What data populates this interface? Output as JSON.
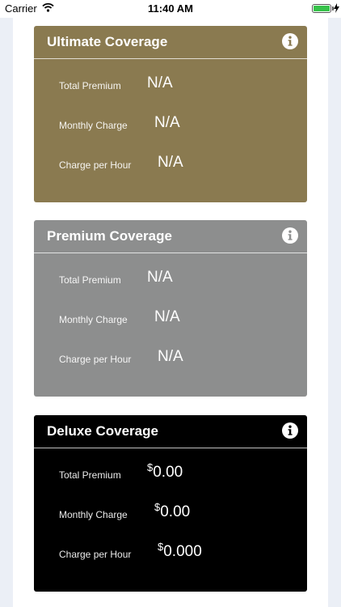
{
  "status_bar": {
    "carrier": "Carrier",
    "time": "11:40 AM"
  },
  "colors": {
    "ultimate": "#8a7a50",
    "premium": "#8d8e8e",
    "deluxe": "#000000",
    "battery": "#36c24a"
  },
  "cards": [
    {
      "title": "Ultimate Coverage",
      "rows": [
        {
          "label": "Total Premium",
          "currency": "",
          "value": "N/A"
        },
        {
          "label": "Monthly Charge",
          "currency": "",
          "value": "N/A"
        },
        {
          "label": "Charge per Hour",
          "currency": "",
          "value": "N/A"
        }
      ]
    },
    {
      "title": "Premium Coverage",
      "rows": [
        {
          "label": "Total Premium",
          "currency": "",
          "value": "N/A"
        },
        {
          "label": "Monthly Charge",
          "currency": "",
          "value": "N/A"
        },
        {
          "label": "Charge per Hour",
          "currency": "",
          "value": "N/A"
        }
      ]
    },
    {
      "title": "Deluxe Coverage",
      "rows": [
        {
          "label": "Total Premium",
          "currency": "$",
          "value": "0.00"
        },
        {
          "label": "Monthly Charge",
          "currency": "$",
          "value": "0.00"
        },
        {
          "label": "Charge per Hour",
          "currency": "$",
          "value": "0.000"
        }
      ]
    }
  ]
}
